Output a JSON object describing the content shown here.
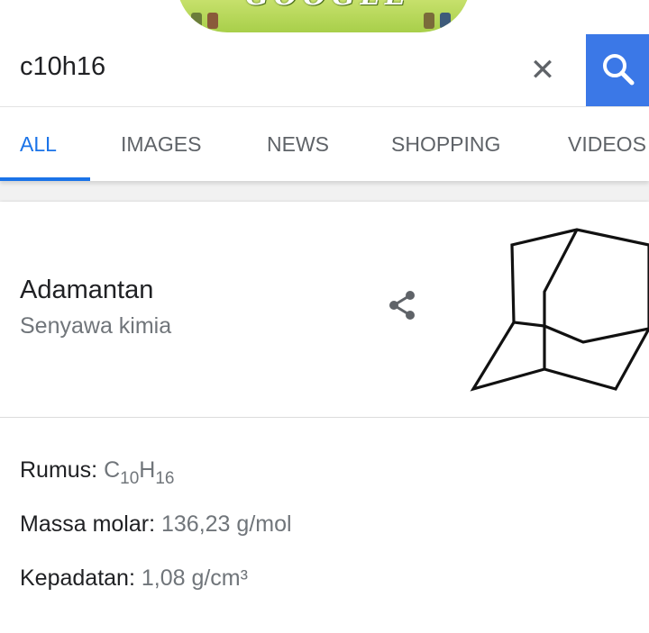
{
  "doodle": {
    "text": "GOOGLE"
  },
  "search": {
    "query": "c10h16",
    "clear_icon": "close-icon",
    "search_icon": "search-icon",
    "accent": "#3b78e7"
  },
  "tabs": [
    {
      "label": "ALL",
      "active": true
    },
    {
      "label": "IMAGES"
    },
    {
      "label": "NEWS"
    },
    {
      "label": "SHOPPING"
    },
    {
      "label": "VIDEOS"
    }
  ],
  "entity": {
    "title": "Adamantan",
    "subtitle": "Senyawa kimia",
    "share_icon": "share-icon",
    "image_icon": "adamantane-structure"
  },
  "facts": [
    {
      "label": "Rumus:",
      "value": {
        "c": "C",
        "n1": "10",
        "h": "H",
        "n2": "16"
      }
    },
    {
      "label": "Massa molar:",
      "value": "136,23 g/mol"
    },
    {
      "label": "Kepadatan:",
      "value": "1,08 g/cm³"
    }
  ]
}
